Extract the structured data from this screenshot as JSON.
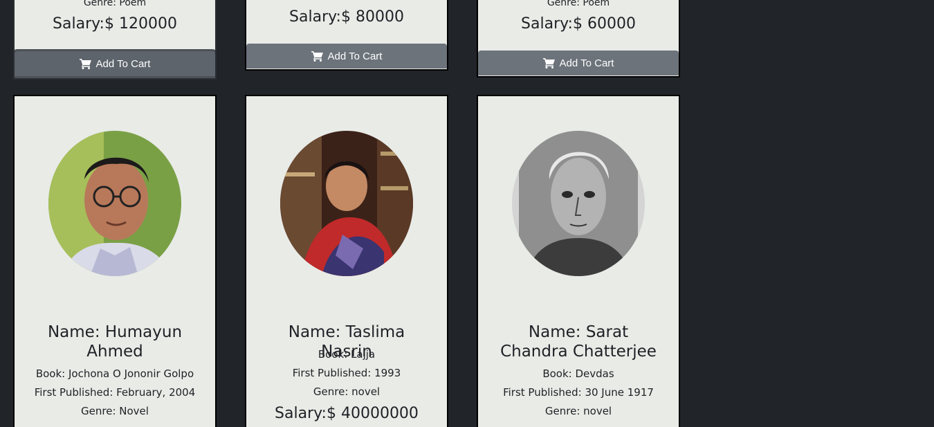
{
  "top_cards": [
    {
      "genre": "Genre: Poem",
      "salary": "Salary:$ 120000",
      "button_label": "Add To Cart"
    },
    {
      "genre": "",
      "salary": "Salary:$ 80000",
      "button_label": "Add To Cart"
    },
    {
      "genre": "Genre: Poem",
      "salary": "Salary:$ 60000",
      "button_label": "Add To Cart"
    }
  ],
  "bottom_cards": [
    {
      "name": "Name: Humayun Ahmed",
      "book": "Book: Jochona O Jononir Golpo",
      "published": "First Published: February, 2004",
      "genre": "Genre: Novel"
    },
    {
      "name": "Name: Taslima Nasrin",
      "book": "Book: Lajja",
      "published": "First Published: 1993",
      "genre": "Genre: novel",
      "salary": "Salary:$ 40000000"
    },
    {
      "name": "Name: Sarat Chandra Chatterjee",
      "book": "Book: Devdas",
      "published": "First Published: 30 June 1917",
      "genre": "Genre: novel"
    }
  ],
  "icons": {
    "cart": "shopping-cart-icon"
  },
  "colors": {
    "page_bg": "#212429",
    "card_bg": "#e9ebe7",
    "button_bg": "#6c737b"
  }
}
